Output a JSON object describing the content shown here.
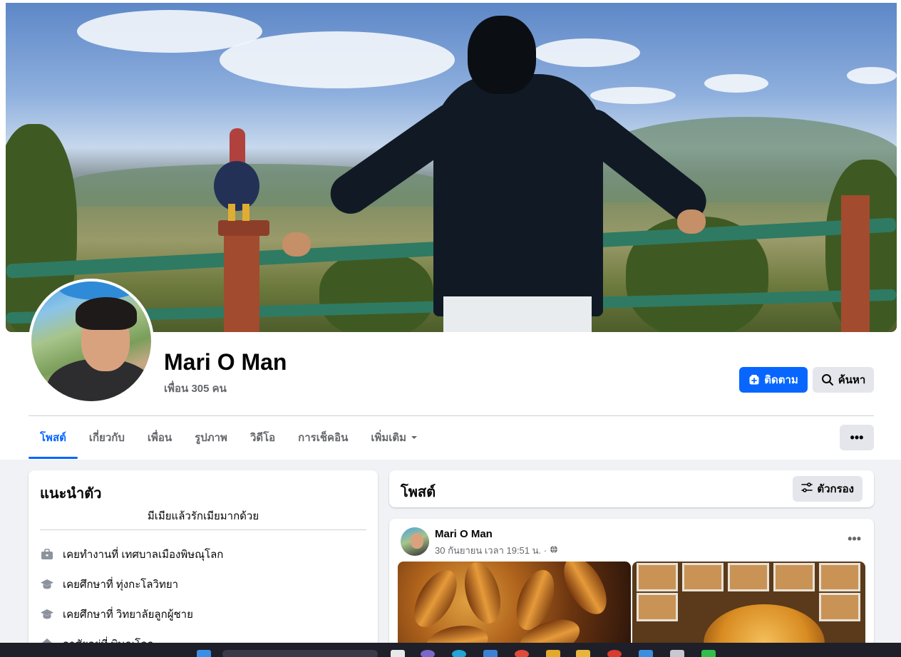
{
  "profile": {
    "name": "Mari O Man",
    "friends": "เพื่อน 305 คน",
    "follow_label": "ติดตาม",
    "search_label": "ค้นหา"
  },
  "tabs": [
    {
      "label": "โพสต์",
      "active": true
    },
    {
      "label": "เกี่ยวกับ",
      "active": false
    },
    {
      "label": "เพื่อน",
      "active": false
    },
    {
      "label": "รูปภาพ",
      "active": false
    },
    {
      "label": "วิดีโอ",
      "active": false
    },
    {
      "label": "การเช็คอิน",
      "active": false
    },
    {
      "label": "เพิ่มเติม",
      "active": false,
      "dropdown": true
    }
  ],
  "more_options": "•••",
  "intro": {
    "title": "แนะนำตัว",
    "bio": "มีเมียแล้วรักเมียมากด้วย",
    "items": [
      {
        "icon": "briefcase-icon",
        "text": "เคยทำงานที่ เทศบาลเมืองพิษณุโลก"
      },
      {
        "icon": "graduation-cap-icon",
        "text": "เคยศึกษาที่ ทุ่งกะโลวิทยา"
      },
      {
        "icon": "graduation-cap-icon",
        "text": "เคยศึกษาที่ วิทยาลัยลูกผู้ชาย"
      },
      {
        "icon": "home-icon",
        "text": "อาศัยอยู่ที่ พิษณุโลก"
      }
    ]
  },
  "posts": {
    "title": "โพสต์",
    "filter_label": "ตัวกรอง",
    "items": [
      {
        "author": "Mari O Man",
        "timestamp": "30 กันยายน เวลา 19:51 น. ·",
        "privacy_icon": "globe-icon",
        "menu": "•••"
      }
    ]
  },
  "colors": {
    "accent": "#0866ff",
    "secondary_button": "#e4e6eb",
    "page_background": "#f0f2f5",
    "muted_text": "#65676b"
  }
}
